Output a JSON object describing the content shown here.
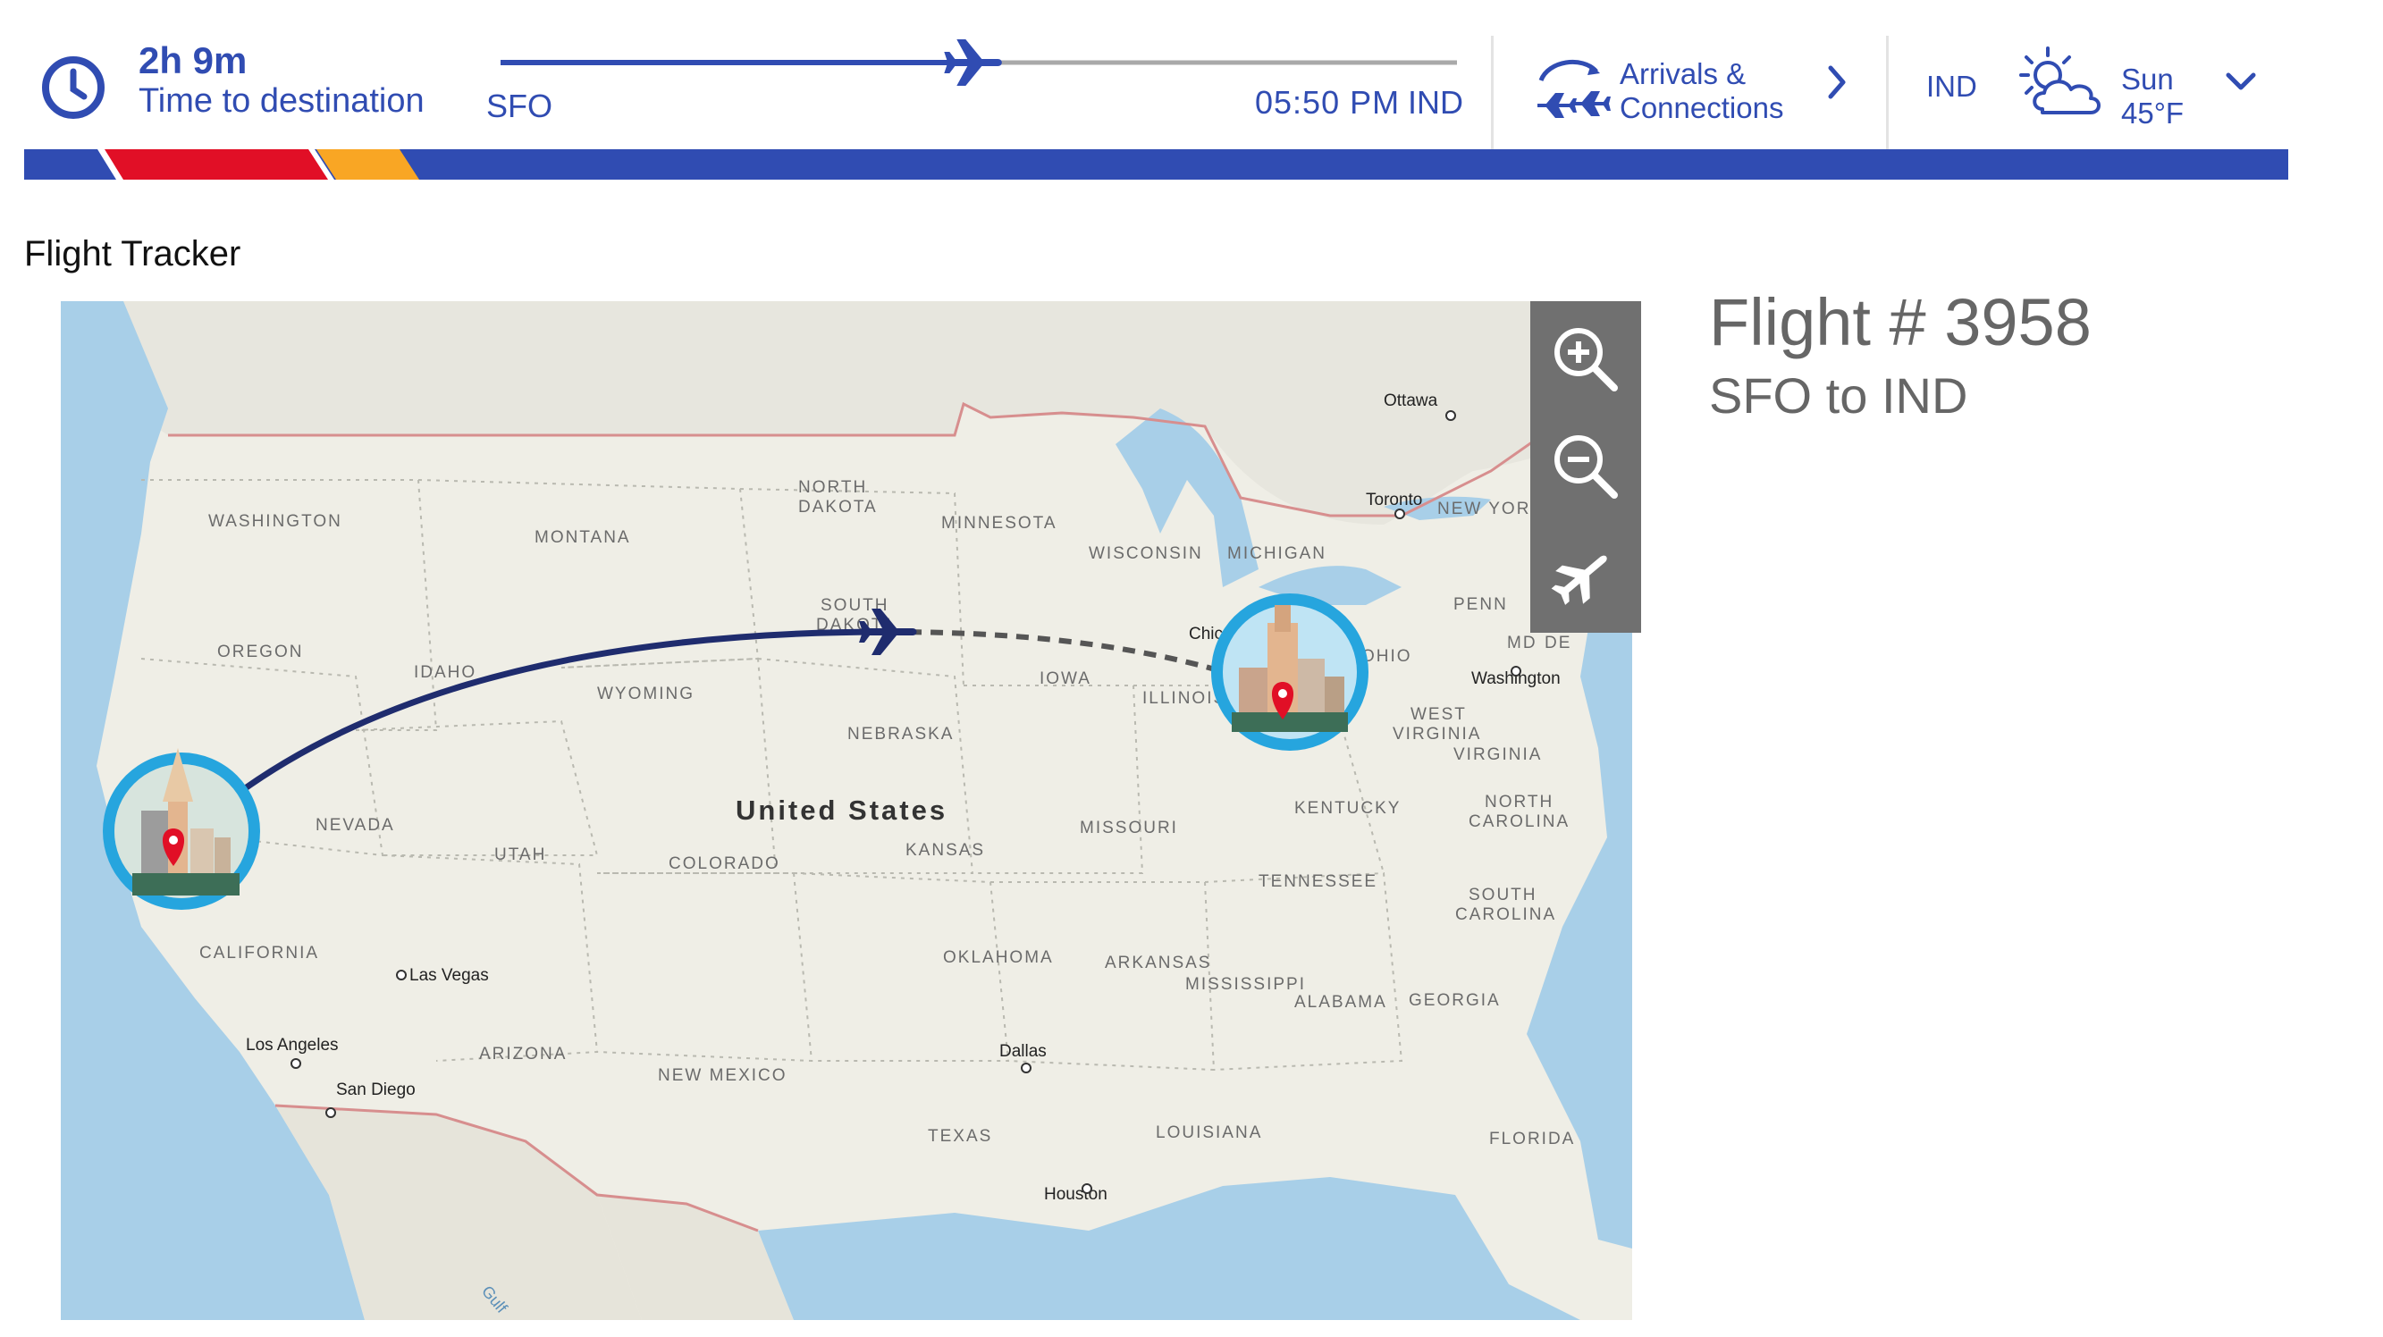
{
  "header": {
    "time_to_destination": {
      "value": "2h 9m",
      "label": "Time to destination",
      "icon": "clock-icon"
    },
    "progress": {
      "origin": "SFO",
      "eta": "05:50 PM",
      "destination": "IND",
      "fraction_complete": 0.49,
      "icon": "airplane-icon"
    },
    "arrivals": {
      "label_line1": "Arrivals &",
      "label_line2": "Connections",
      "icon": "arrivals-connections-icon",
      "chevron": "chevron-right-icon"
    },
    "weather": {
      "airport": "IND",
      "day": "Sun",
      "temperature": "45°F",
      "icon": "partly-cloudy-icon",
      "chevron": "chevron-down-icon"
    }
  },
  "brand_colors": {
    "blue": "#304cb2",
    "red": "#e10f26",
    "yellow": "#f9a624",
    "navy": "#1f2c6e"
  },
  "section_title": "Flight Tracker",
  "flight": {
    "number_label": "Flight # 3958",
    "route_label": "SFO to IND"
  },
  "map": {
    "country_label": "United States",
    "region_labels": [
      "WASHINGTON",
      "MONTANA",
      "NORTH",
      "DAKOTA",
      "MINNESOTA",
      "WISCONSIN",
      "MICHIGAN",
      "OREGON",
      "IDAHO",
      "WYOMING",
      "SOUTH",
      "DAKOTA",
      "IOWA",
      "ILLINOIS",
      "NEBRASKA",
      "NEVADA",
      "UTAH",
      "COLORADO",
      "KANSAS",
      "MISSOURI",
      "KENTUCKY",
      "CALIFORNIA",
      "OKLAHOMA",
      "ARKANSAS",
      "TENNESSEE",
      "MISSISSIPPI",
      "ALABAMA",
      "GEORGIA",
      "ARIZONA",
      "NEW MEXICO",
      "TEXAS",
      "LOUISIANA",
      "FLORIDA",
      "NORTH",
      "CAROLINA",
      "SOUTH",
      "CAROLINA",
      "WEST",
      "VIRGINIA",
      "VIRGINIA",
      "PENN",
      "NEW YORK",
      "MD",
      "DE",
      "OHIO"
    ],
    "city_labels": [
      "Ottawa",
      "Toronto",
      "Chicago",
      "Washington",
      "Las Vegas",
      "Los Angeles",
      "San Diego",
      "Dallas",
      "Houston"
    ],
    "water_label": "Gulf",
    "origin_badge": "origin-city-badge",
    "destination_badge": "destination-city-badge",
    "controls": [
      {
        "name": "zoom-in",
        "icon": "zoom-in-icon"
      },
      {
        "name": "zoom-out",
        "icon": "zoom-out-icon"
      },
      {
        "name": "center-flight",
        "icon": "airplane-icon"
      }
    ]
  }
}
